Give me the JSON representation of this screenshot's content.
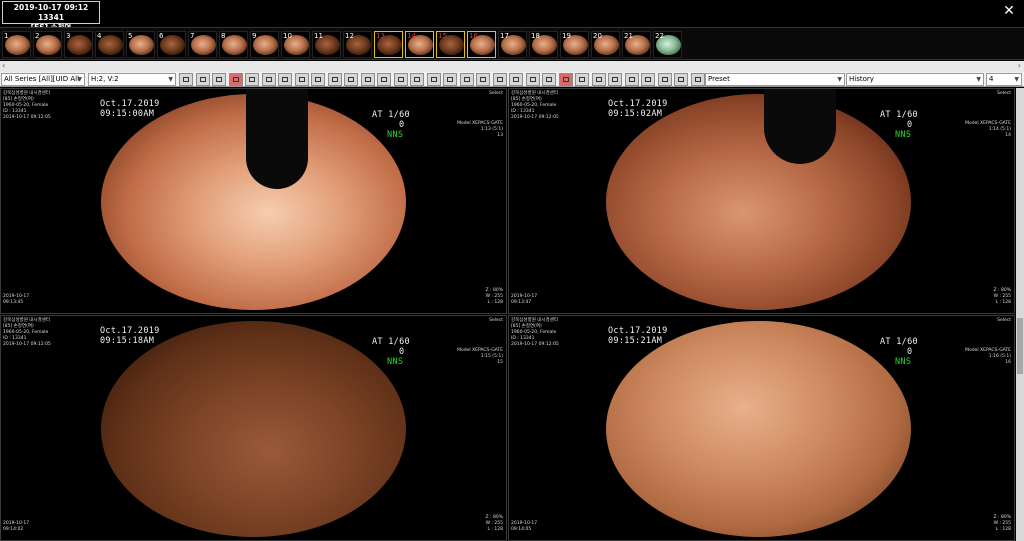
{
  "header": {
    "study_line1": "2019-10-17 09:12 13341",
    "study_line2": "[ES] 손정연"
  },
  "thumbnails": [
    {
      "n": "1",
      "style": "light",
      "red": false,
      "sel": false
    },
    {
      "n": "2",
      "style": "light",
      "red": false,
      "sel": false
    },
    {
      "n": "3",
      "style": "dark",
      "red": false,
      "sel": false
    },
    {
      "n": "4",
      "style": "dark",
      "red": false,
      "sel": false
    },
    {
      "n": "5",
      "style": "light",
      "red": false,
      "sel": false
    },
    {
      "n": "6",
      "style": "dark",
      "red": false,
      "sel": false
    },
    {
      "n": "7",
      "style": "light",
      "red": false,
      "sel": false
    },
    {
      "n": "8",
      "style": "light",
      "red": false,
      "sel": false
    },
    {
      "n": "9",
      "style": "light",
      "red": false,
      "sel": false
    },
    {
      "n": "10",
      "style": "light",
      "red": false,
      "sel": false
    },
    {
      "n": "11",
      "style": "dark",
      "red": false,
      "sel": false
    },
    {
      "n": "12",
      "style": "dark",
      "red": false,
      "sel": false
    },
    {
      "n": "13",
      "style": "dark",
      "red": true,
      "sel": true
    },
    {
      "n": "14",
      "style": "light",
      "red": true,
      "sel": true
    },
    {
      "n": "15",
      "style": "dark",
      "red": true,
      "sel": true
    },
    {
      "n": "16",
      "style": "light",
      "red": true,
      "sel": true
    },
    {
      "n": "17",
      "style": "light",
      "red": false,
      "sel": false
    },
    {
      "n": "18",
      "style": "light",
      "red": false,
      "sel": false
    },
    {
      "n": "19",
      "style": "light",
      "red": false,
      "sel": false
    },
    {
      "n": "20",
      "style": "light",
      "red": false,
      "sel": false
    },
    {
      "n": "21",
      "style": "light",
      "red": false,
      "sel": false
    },
    {
      "n": "22",
      "style": "green",
      "red": false,
      "sel": false
    }
  ],
  "toolbar": {
    "series_select": "All Series [All][UID All",
    "layout_select": "H:2, V:2",
    "preset_select": "Preset",
    "history_select": "History",
    "count_select": "4"
  },
  "tool_icons": [
    "grid-icon",
    "grid-icon",
    "rotate-icon",
    "delete-icon",
    "zoom-icon",
    "forward-icon",
    "forward-icon",
    "audio-icon",
    "undo-icon",
    "redo-icon",
    "layout-icon",
    "measure-icon",
    "crop-icon",
    "pan-icon",
    "marker-icon",
    "text-icon",
    "frame-icon",
    "window-icon",
    "circle-icon",
    "arrow-icon",
    "scroll-icon",
    "line-icon",
    "invert-icon",
    "image-icon",
    "export-icon",
    "print-icon",
    "save-icon",
    "crop2-icon",
    "copy-icon",
    "video-icon",
    "eye-icon",
    "gear-icon",
    "more-icon"
  ],
  "panes": [
    {
      "hospital": "강북삼성병원 내시경센터",
      "patient_line": "[85] 손정연(여)",
      "dob": "1960-05-20, Female",
      "id": "ID : 13341",
      "study_dt": "2019-10-17 09:12:05",
      "select": "Select",
      "date": "Oct.17.2019",
      "time": "09:15:00AM",
      "at": "AT  1/60",
      "zero": "0",
      "nns": "NNS",
      "model": "Model XEPACS-GATE",
      "frame": "1:13 (5:1)",
      "frame_num": "13",
      "bl_date": "2019-10-17",
      "bl_time": "09:13:45",
      "zoom": "Z : 80%",
      "w": "W : 255",
      "l": "L : 128"
    },
    {
      "hospital": "강북삼성병원 내시경센터",
      "patient_line": "[85] 손정연(여)",
      "dob": "1960-05-20, Female",
      "id": "ID : 13341",
      "study_dt": "2019-10-17 09:12:05",
      "select": "Select",
      "date": "Oct.17.2019",
      "time": "09:15:02AM",
      "at": "AT  1/60",
      "zero": "0",
      "nns": "NNS",
      "model": "Model XEPACS-GATE",
      "frame": "1:14 (5:1)",
      "frame_num": "14",
      "bl_date": "2019-10-17",
      "bl_time": "09:13:47",
      "zoom": "Z : 80%",
      "w": "W : 255",
      "l": "L : 128"
    },
    {
      "hospital": "강북삼성병원 내시경센터",
      "patient_line": "[85] 손정연(여)",
      "dob": "1960-05-20, Female",
      "id": "ID : 13341",
      "study_dt": "2019-10-17 09:12:05",
      "select": "Select",
      "date": "Oct.17.2019",
      "time": "09:15:18AM",
      "at": "AT  1/60",
      "zero": "0",
      "nns": "NNS",
      "model": "Model XEPACS-GATE",
      "frame": "1:15 (5:1)",
      "frame_num": "15",
      "bl_date": "2019-10-17",
      "bl_time": "09:14:02",
      "zoom": "Z : 80%",
      "w": "W : 255",
      "l": "L : 128"
    },
    {
      "hospital": "강북삼성병원 내시경센터",
      "patient_line": "[85] 손정연(여)",
      "dob": "1960-05-20, Female",
      "id": "ID : 13341",
      "study_dt": "2019-10-17 09:12:05",
      "select": "Select",
      "date": "Oct.17.2019",
      "time": "09:15:21AM",
      "at": "AT  1/60",
      "zero": "0",
      "nns": "NNS",
      "model": "Model XEPACS-GATE",
      "frame": "1:16 (5:1)",
      "frame_num": "16",
      "bl_date": "2019-10-17",
      "bl_time": "09:14:05",
      "zoom": "Z : 80%",
      "w": "W : 255",
      "l": "L : 128"
    }
  ],
  "colors": {
    "selected_thumb_border": "#e6c200",
    "red_number": "#ff2a2a",
    "nns_green": "#29d629"
  }
}
